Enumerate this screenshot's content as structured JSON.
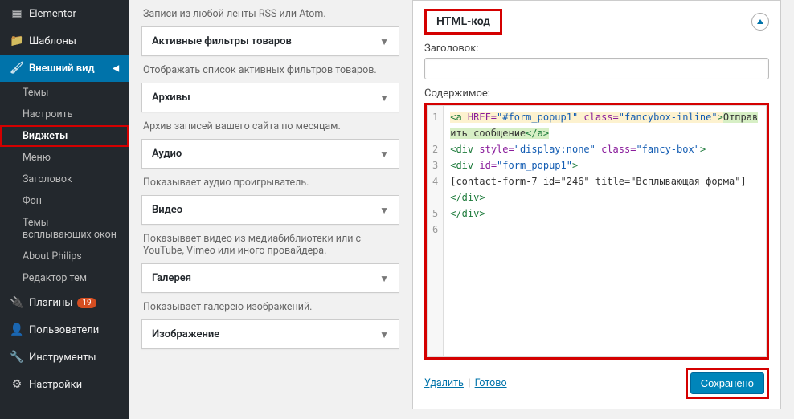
{
  "sidebar": {
    "elementor": "Elementor",
    "templates": "Шаблоны",
    "appearance": "Внешний вид",
    "sub": {
      "themes": "Темы",
      "customize": "Настроить",
      "widgets": "Виджеты",
      "menus": "Меню",
      "header": "Заголовок",
      "background": "Фон",
      "popup_themes": "Темы всплывающих окон",
      "about": "About Philips",
      "editor": "Редактор тем"
    },
    "plugins": "Плагины",
    "plugins_badge": "19",
    "users": "Пользователи",
    "tools": "Инструменты",
    "settings": "Настройки"
  },
  "widgets": [
    {
      "title": "Активные фильтры товаров",
      "hint": "Записи из любой ленты RSS или Atom."
    },
    {
      "title": "Архивы",
      "hint": "Отображать список активных фильтров товаров."
    },
    {
      "title": "Аудио",
      "hint": "Архив записей вашего сайта по месяцам."
    },
    {
      "title": "Видео",
      "hint": "Показывает аудио проигрыватель."
    },
    {
      "title": "Галерея",
      "hint": "Показывает видео из медиабиблиотеки или с YouTube, Vimeo или иного провайдера."
    },
    {
      "title": "Изображение",
      "hint": "Показывает галерею изображений."
    }
  ],
  "panel": {
    "title": "HTML-код",
    "label_title": "Заголовок:",
    "label_content": "Содержимое:",
    "delete": "Удалить",
    "done": "Готово",
    "saved": "Сохранено",
    "code": {
      "lines": [
        "1",
        "2",
        "3",
        "4",
        "",
        "5",
        "6"
      ],
      "l1a": "<a",
      "l1b": " HREF=",
      "l1c": "\"#form_popup1\"",
      "l1d": " class=",
      "l1e": "\"fancybox-inline\"",
      "l1f": ">",
      "l1g": "Отправить сообщение",
      "l1h": "</a>",
      "l2a": "<div",
      "l2b": " style=",
      "l2c": "\"display:none\"",
      "l2d": " class=",
      "l2e": "\"fancy-box\"",
      "l2f": ">",
      "l3a": "<div",
      "l3b": " id=",
      "l3c": "\"form_popup1\"",
      "l3d": ">",
      "l4": "[contact-form-7 id=\"246\" title=\"Всплывающая форма\"]",
      "l5": "</div>",
      "l6": "</div>"
    }
  }
}
